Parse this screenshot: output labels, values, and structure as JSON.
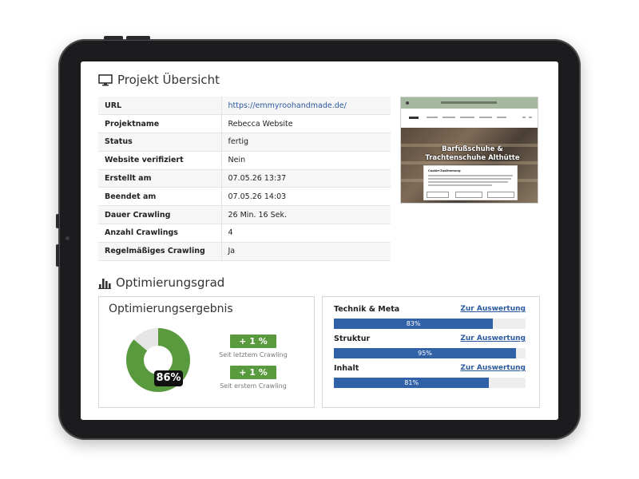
{
  "projekt": {
    "title": "Projekt Übersicht",
    "rows": [
      {
        "key": "URL",
        "value": "https://emmyroohandmade.de/",
        "link": true
      },
      {
        "key": "Projektname",
        "value": "Rebecca Website"
      },
      {
        "key": "Status",
        "value": "fertig"
      },
      {
        "key": "Website verifiziert",
        "value": "Nein"
      },
      {
        "key": "Erstellt am",
        "value": "07.05.26 13:37"
      },
      {
        "key": "Beendet am",
        "value": "07.05.26 14:03"
      },
      {
        "key": "Dauer Crawling",
        "value": "26 Min. 16 Sek."
      },
      {
        "key": "Anzahl Crawlings",
        "value": "4"
      },
      {
        "key": "Regelmäßiges Crawling",
        "value": "Ja"
      }
    ],
    "thumbnail": {
      "hero_line1": "Barfußschuhe &",
      "hero_line2": "Trachtenschuhe Althütte",
      "modal_heading": "Cookie-Zustimmung"
    }
  },
  "optimierung": {
    "title": "Optimierungsgrad",
    "ergebnis": {
      "title": "Optimierungsergebnis",
      "score_value": 86,
      "score_label": "86%",
      "badge_last": "+ 1 %",
      "caption_last": "Seit letztem Crawling",
      "badge_first": "+ 1 %",
      "caption_first": "Seit erstem Crawling"
    },
    "kategorien": [
      {
        "label": "Technik & Meta",
        "link": "Zur Auswertung",
        "value": 83,
        "value_label": "83%"
      },
      {
        "label": "Struktur",
        "link": "Zur Auswertung",
        "value": 95,
        "value_label": "95%"
      },
      {
        "label": "Inhalt",
        "link": "Zur Auswertung",
        "value": 81,
        "value_label": "81%"
      }
    ]
  },
  "colors": {
    "accent_blue": "#3162a8",
    "success_green": "#5a9a3e",
    "donut_remainder": "#e6e6e6",
    "link_blue": "#2b5aa0"
  },
  "icons": {
    "projekt": "monitor-icon",
    "optimierung": "bar-chart-icon"
  }
}
